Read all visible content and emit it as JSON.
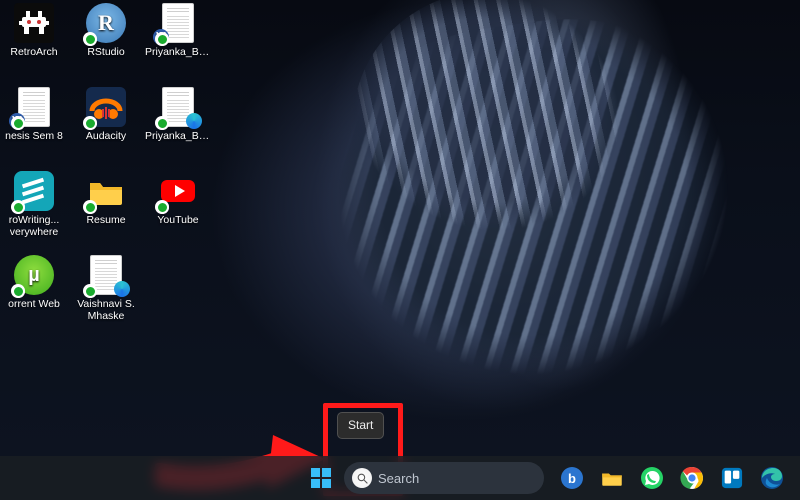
{
  "wallpaper": {
    "description": "abstract-cloth-dark"
  },
  "tooltip": {
    "start_label": "Start"
  },
  "search": {
    "placeholder": "Search"
  },
  "desktop": {
    "icons": [
      {
        "id": "retroarch",
        "label": "RetroArch",
        "label2": ""
      },
      {
        "id": "rstudio",
        "label": "RStudio",
        "label2": ""
      },
      {
        "id": "priyanka1",
        "label": "Priyanka_Ba...",
        "label2": ""
      },
      {
        "id": "thesis",
        "label": "nesis Sem 8",
        "label2": ""
      },
      {
        "id": "audacity",
        "label": "Audacity",
        "label2": ""
      },
      {
        "id": "priyanka2",
        "label": "Priyanka_Ba...",
        "label2": ""
      },
      {
        "id": "prowrite",
        "label": "roWriting...",
        "label2": "verywhere"
      },
      {
        "id": "resume",
        "label": "Resume",
        "label2": ""
      },
      {
        "id": "youtube",
        "label": "YouTube",
        "label2": ""
      },
      {
        "id": "utorrent",
        "label": "orrent Web",
        "label2": ""
      },
      {
        "id": "vaishnavi",
        "label": "Vaishnavi S.",
        "label2": "Mhaske"
      }
    ]
  },
  "taskbar": {
    "items": [
      {
        "id": "start",
        "name": "start-button",
        "icon": "windows-logo-icon"
      },
      {
        "id": "search",
        "name": "taskbar-search",
        "icon": "search-icon"
      },
      {
        "id": "bing",
        "name": "bing-chat-button",
        "icon": "bing-icon"
      },
      {
        "id": "explorer",
        "name": "file-explorer-button",
        "icon": "folder-icon"
      },
      {
        "id": "whatsapp",
        "name": "whatsapp-button",
        "icon": "whatsapp-icon"
      },
      {
        "id": "chrome",
        "name": "chrome-button",
        "icon": "chrome-icon"
      },
      {
        "id": "trello",
        "name": "trello-button",
        "icon": "trello-icon"
      },
      {
        "id": "edge",
        "name": "edge-button",
        "icon": "edge-icon"
      }
    ]
  },
  "annotation": {
    "highlight_target": "start-button",
    "has_arrow": true
  },
  "colors": {
    "annotation_red": "#ff1a1a",
    "taskbar": "#1d232b",
    "tooltip_bg": "#2c2c2c"
  }
}
